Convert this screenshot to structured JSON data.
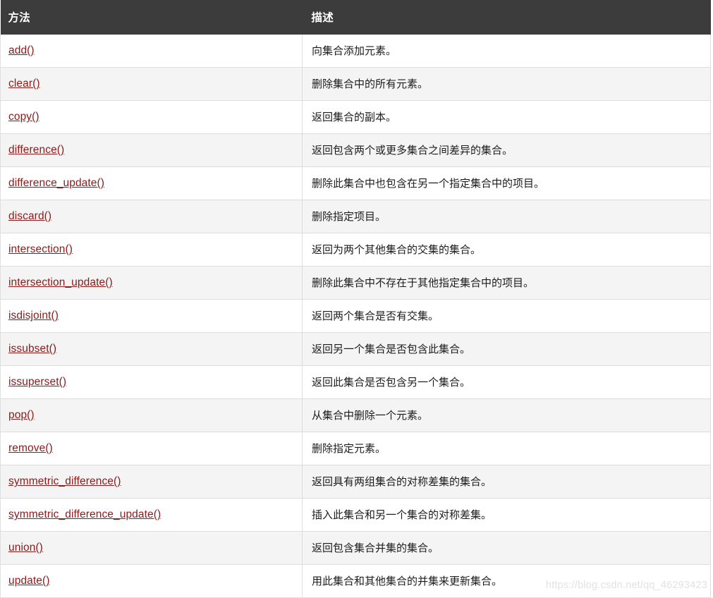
{
  "table": {
    "columns": [
      {
        "key": "method",
        "label": "方法"
      },
      {
        "key": "description",
        "label": "描述"
      }
    ],
    "rows": [
      {
        "method": "add()",
        "description": "向集合添加元素。"
      },
      {
        "method": "clear()",
        "description": "删除集合中的所有元素。"
      },
      {
        "method": "copy()",
        "description": "返回集合的副本。"
      },
      {
        "method": "difference()",
        "description": "返回包含两个或更多集合之间差异的集合。"
      },
      {
        "method": "difference_update()",
        "description": "删除此集合中也包含在另一个指定集合中的项目。"
      },
      {
        "method": "discard()",
        "description": "删除指定项目。"
      },
      {
        "method": "intersection()",
        "description": "返回为两个其他集合的交集的集合。"
      },
      {
        "method": "intersection_update()",
        "description": "删除此集合中不存在于其他指定集合中的项目。"
      },
      {
        "method": "isdisjoint()",
        "description": "返回两个集合是否有交集。"
      },
      {
        "method": "issubset()",
        "description": "返回另一个集合是否包含此集合。"
      },
      {
        "method": "issuperset()",
        "description": "返回此集合是否包含另一个集合。"
      },
      {
        "method": "pop()",
        "description": "从集合中删除一个元素。"
      },
      {
        "method": "remove()",
        "description": "删除指定元素。"
      },
      {
        "method": "symmetric_difference()",
        "description": "返回具有两组集合的对称差集的集合。"
      },
      {
        "method": "symmetric_difference_update()",
        "description": "插入此集合和另一个集合的对称差集。"
      },
      {
        "method": "union()",
        "description": "返回包含集合并集的集合。"
      },
      {
        "method": "update()",
        "description": "用此集合和其他集合的并集来更新集合。"
      }
    ]
  },
  "watermark": {
    "text": "https://blog.csdn.net/qq_46293423"
  },
  "colors": {
    "header_background": "#3c3c3c",
    "header_text": "#ffffff",
    "link": "#8b1a1a",
    "row_stripe": "#f4f4f4",
    "row_base": "#ffffff",
    "border": "#dddddd",
    "watermark": "#e2e2e2"
  }
}
